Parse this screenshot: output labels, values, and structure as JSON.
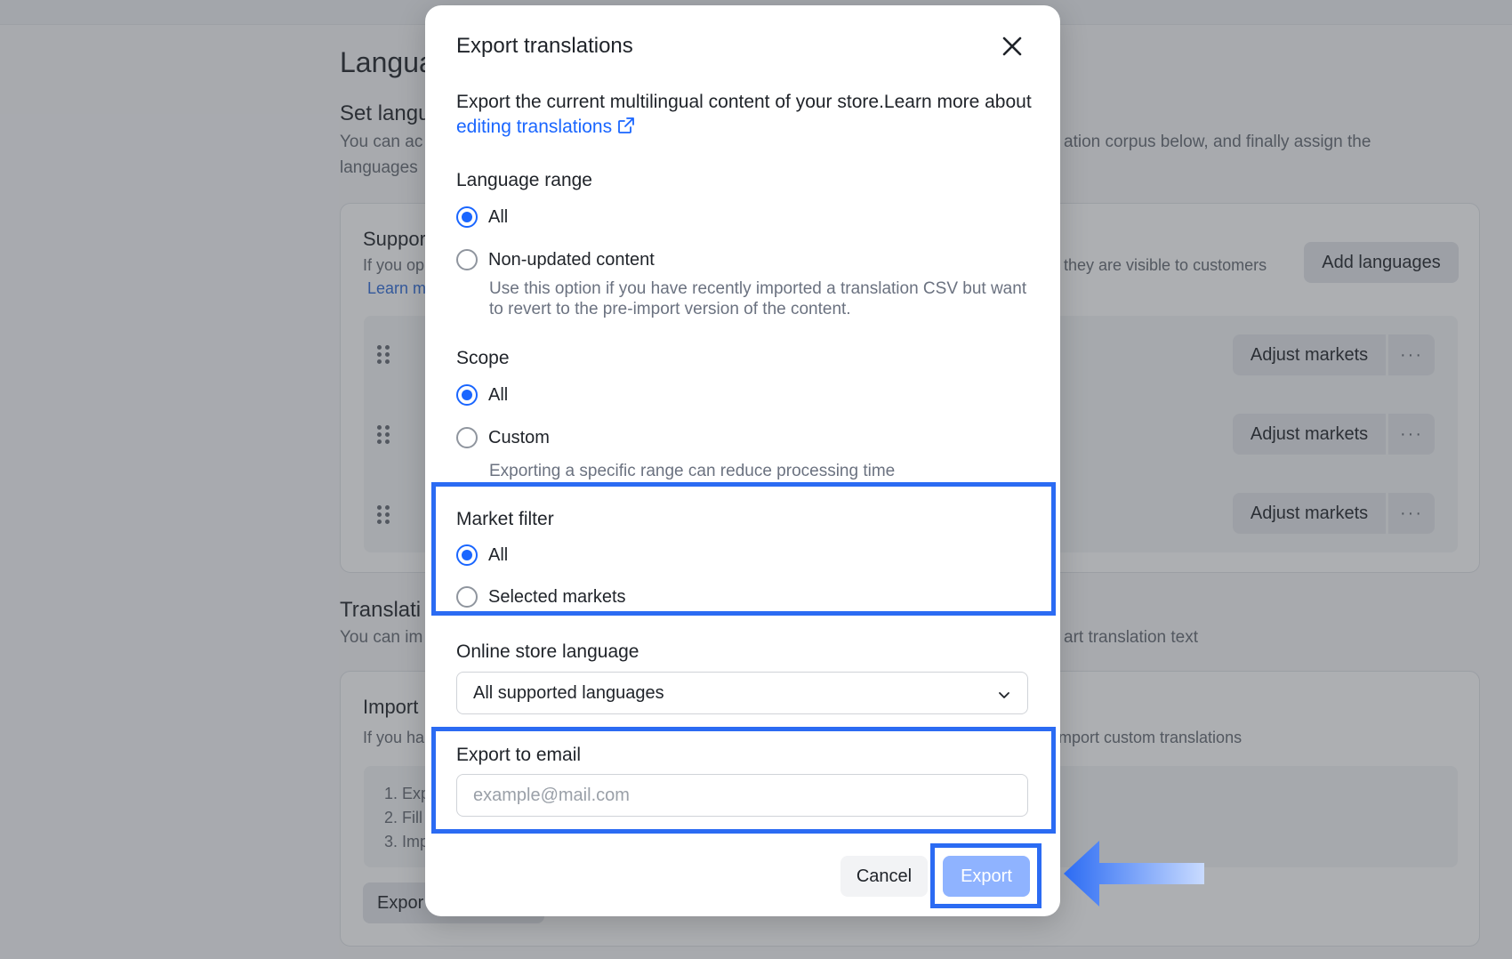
{
  "background": {
    "page_title": "Langua",
    "set_lang_heading": "Set langu",
    "set_lang_desc_left_1": "You can ac",
    "set_lang_desc_left_2": "languages",
    "set_lang_desc_right": "ation corpus below, and finally assign the",
    "supported_heading": "Suppor",
    "supported_desc_left": "If you op",
    "supported_learn": "Learn m",
    "supported_desc_right": "they are visible to customers",
    "add_languages": "Add languages",
    "adjust_markets": "Adjust markets",
    "more": "···",
    "translation_heading": "Translati",
    "translation_desc_left": "You can im",
    "translation_desc_right": "art translation text",
    "import_heading": "Import",
    "import_desc_left": "If you ha",
    "import_desc_right": "mport custom translations",
    "steps": [
      "1. Exp",
      "2. Fill",
      "3. Imp"
    ],
    "export_button": "Expor"
  },
  "modal": {
    "title": "Export translations",
    "desc_text": "Export the current multilingual content of your store.Learn more about ",
    "desc_link": "editing translations",
    "language_range": {
      "label": "Language range",
      "options": [
        "All",
        "Non-updated content"
      ],
      "selected": "All",
      "hint": "Use this option if you have recently imported a translation CSV but want to revert to the pre-import version of the content."
    },
    "scope": {
      "label": "Scope",
      "options": [
        "All",
        "Custom"
      ],
      "selected": "All",
      "hint": "Exporting a specific range can reduce processing time"
    },
    "market_filter": {
      "label": "Market filter",
      "options": [
        "All",
        "Selected markets"
      ],
      "selected": "All"
    },
    "online_store_language": {
      "label": "Online store language",
      "value": "All supported languages"
    },
    "export_to_email": {
      "label": "Export to email",
      "placeholder": "example@mail.com",
      "value": ""
    },
    "cancel": "Cancel",
    "export": "Export"
  },
  "colors": {
    "accent": "#1a66ff",
    "highlight": "#2b6bf3",
    "export_disabled": "#8fb3ff"
  }
}
